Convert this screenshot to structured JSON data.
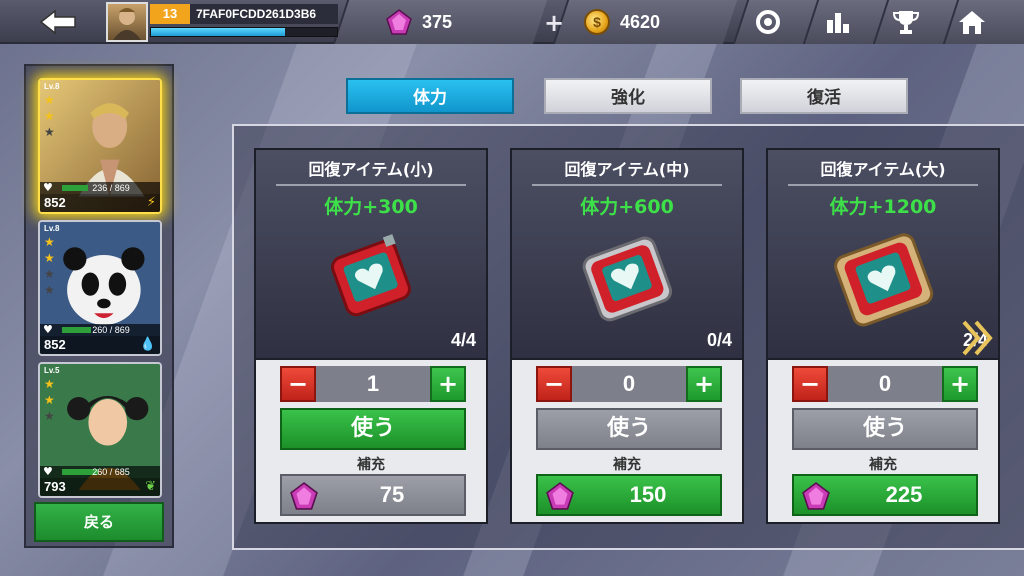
{
  "topbar": {
    "level": "13",
    "player_id": "7FAF0FCDD261D3B6",
    "xp_fraction": 0.72,
    "gems": "375",
    "coins": "4620",
    "coin_symbol": "$",
    "plus_symbol": "+",
    "icons": [
      "back-arrow-icon",
      "settings-gear-icon",
      "ranking-bars-icon",
      "trophy-icon",
      "home-icon"
    ]
  },
  "roster": [
    {
      "level": "Lv.8",
      "hp": "236 / 869",
      "hp_fraction": 0.27,
      "power": "852",
      "element": "lightning",
      "element_glyph": "⚡",
      "selected": true
    },
    {
      "level": "Lv.8",
      "hp": "260 / 869",
      "hp_fraction": 0.3,
      "power": "852",
      "element": "water",
      "element_glyph": "💧",
      "selected": false
    },
    {
      "level": "Lv.5",
      "hp": "260 / 685",
      "hp_fraction": 0.38,
      "power": "793",
      "element": "leaf",
      "element_glyph": "❦",
      "selected": false
    }
  ],
  "back_button": "戻る",
  "tabs": [
    {
      "label": "体力",
      "active": true
    },
    {
      "label": "強化",
      "active": false
    },
    {
      "label": "復活",
      "active": false
    }
  ],
  "items": [
    {
      "name": "回復アイテム(小)",
      "effect": "体力+300",
      "stock": "4/4",
      "qty": "1",
      "use": "使う",
      "use_enabled": true,
      "refill": "補充",
      "price": "75",
      "price_enabled": false
    },
    {
      "name": "回復アイテム(中)",
      "effect": "体力+600",
      "stock": "0/4",
      "qty": "0",
      "use": "使う",
      "use_enabled": false,
      "refill": "補充",
      "price": "150",
      "price_enabled": true
    },
    {
      "name": "回復アイテム(大)",
      "effect": "体力+1200",
      "stock": "2/4",
      "qty": "0",
      "use": "使う",
      "use_enabled": false,
      "refill": "補充",
      "price": "225",
      "price_enabled": true
    }
  ],
  "colors": {
    "accent": "#1196cc",
    "green": "#1d9a2c",
    "red": "#c0221a",
    "gold": "#f2a51c"
  }
}
